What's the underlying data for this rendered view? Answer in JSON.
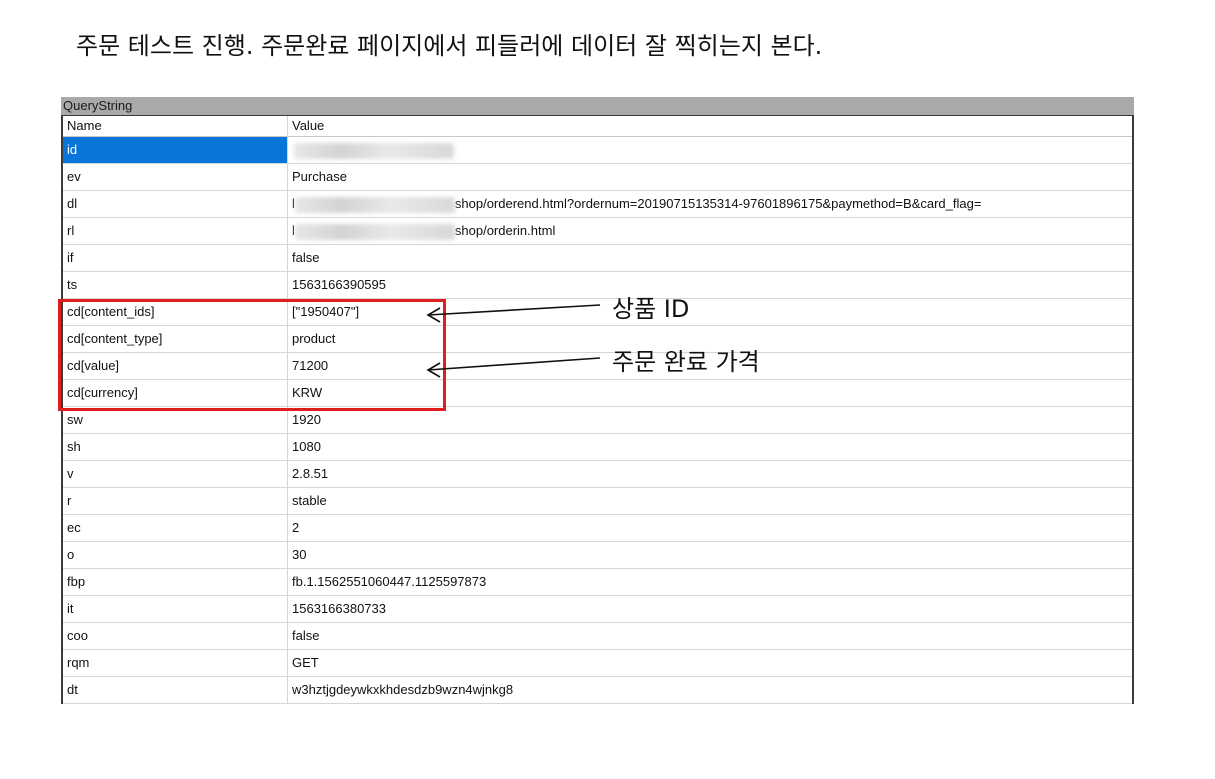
{
  "heading": "주문 테스트 진행.  주문완료 페이지에서 피들러에 데이터 잘 찍히는지 본다.",
  "panel": {
    "title": "QueryString",
    "columns": {
      "name": "Name",
      "value": "Value"
    },
    "rows": [
      {
        "name": "id",
        "value": ""
      },
      {
        "name": "ev",
        "value": "Purchase"
      },
      {
        "name": "dl",
        "value_prefix": "l",
        "value": "shop/orderend.html?ordernum=20190715135314-97601896175&paymethod=B&card_flag="
      },
      {
        "name": "rl",
        "value_prefix": "l",
        "value": "shop/orderin.html"
      },
      {
        "name": "if",
        "value": "false"
      },
      {
        "name": "ts",
        "value": "1563166390595"
      },
      {
        "name": "cd[content_ids]",
        "value": "[\"1950407\"]"
      },
      {
        "name": "cd[content_type]",
        "value": "product"
      },
      {
        "name": "cd[value]",
        "value": "71200"
      },
      {
        "name": "cd[currency]",
        "value": "KRW"
      },
      {
        "name": "sw",
        "value": "1920"
      },
      {
        "name": "sh",
        "value": "1080"
      },
      {
        "name": "v",
        "value": "2.8.51"
      },
      {
        "name": "r",
        "value": "stable"
      },
      {
        "name": "ec",
        "value": "2"
      },
      {
        "name": "o",
        "value": "30"
      },
      {
        "name": "fbp",
        "value": "fb.1.1562551060447.1125597873"
      },
      {
        "name": "it",
        "value": "1563166380733"
      },
      {
        "name": "coo",
        "value": "false"
      },
      {
        "name": "rqm",
        "value": "GET"
      },
      {
        "name": "dt",
        "value": "w3hztjgdeywkxkhdesdzb9wzn4wjnkg8"
      }
    ]
  },
  "annotations": {
    "product_id": "상품 ID",
    "order_price": "주문 완료 가격"
  },
  "colors": {
    "selected": "#0a75d9",
    "highlight_box": "#e01e1e",
    "title_bar": "#a9a9a9"
  }
}
